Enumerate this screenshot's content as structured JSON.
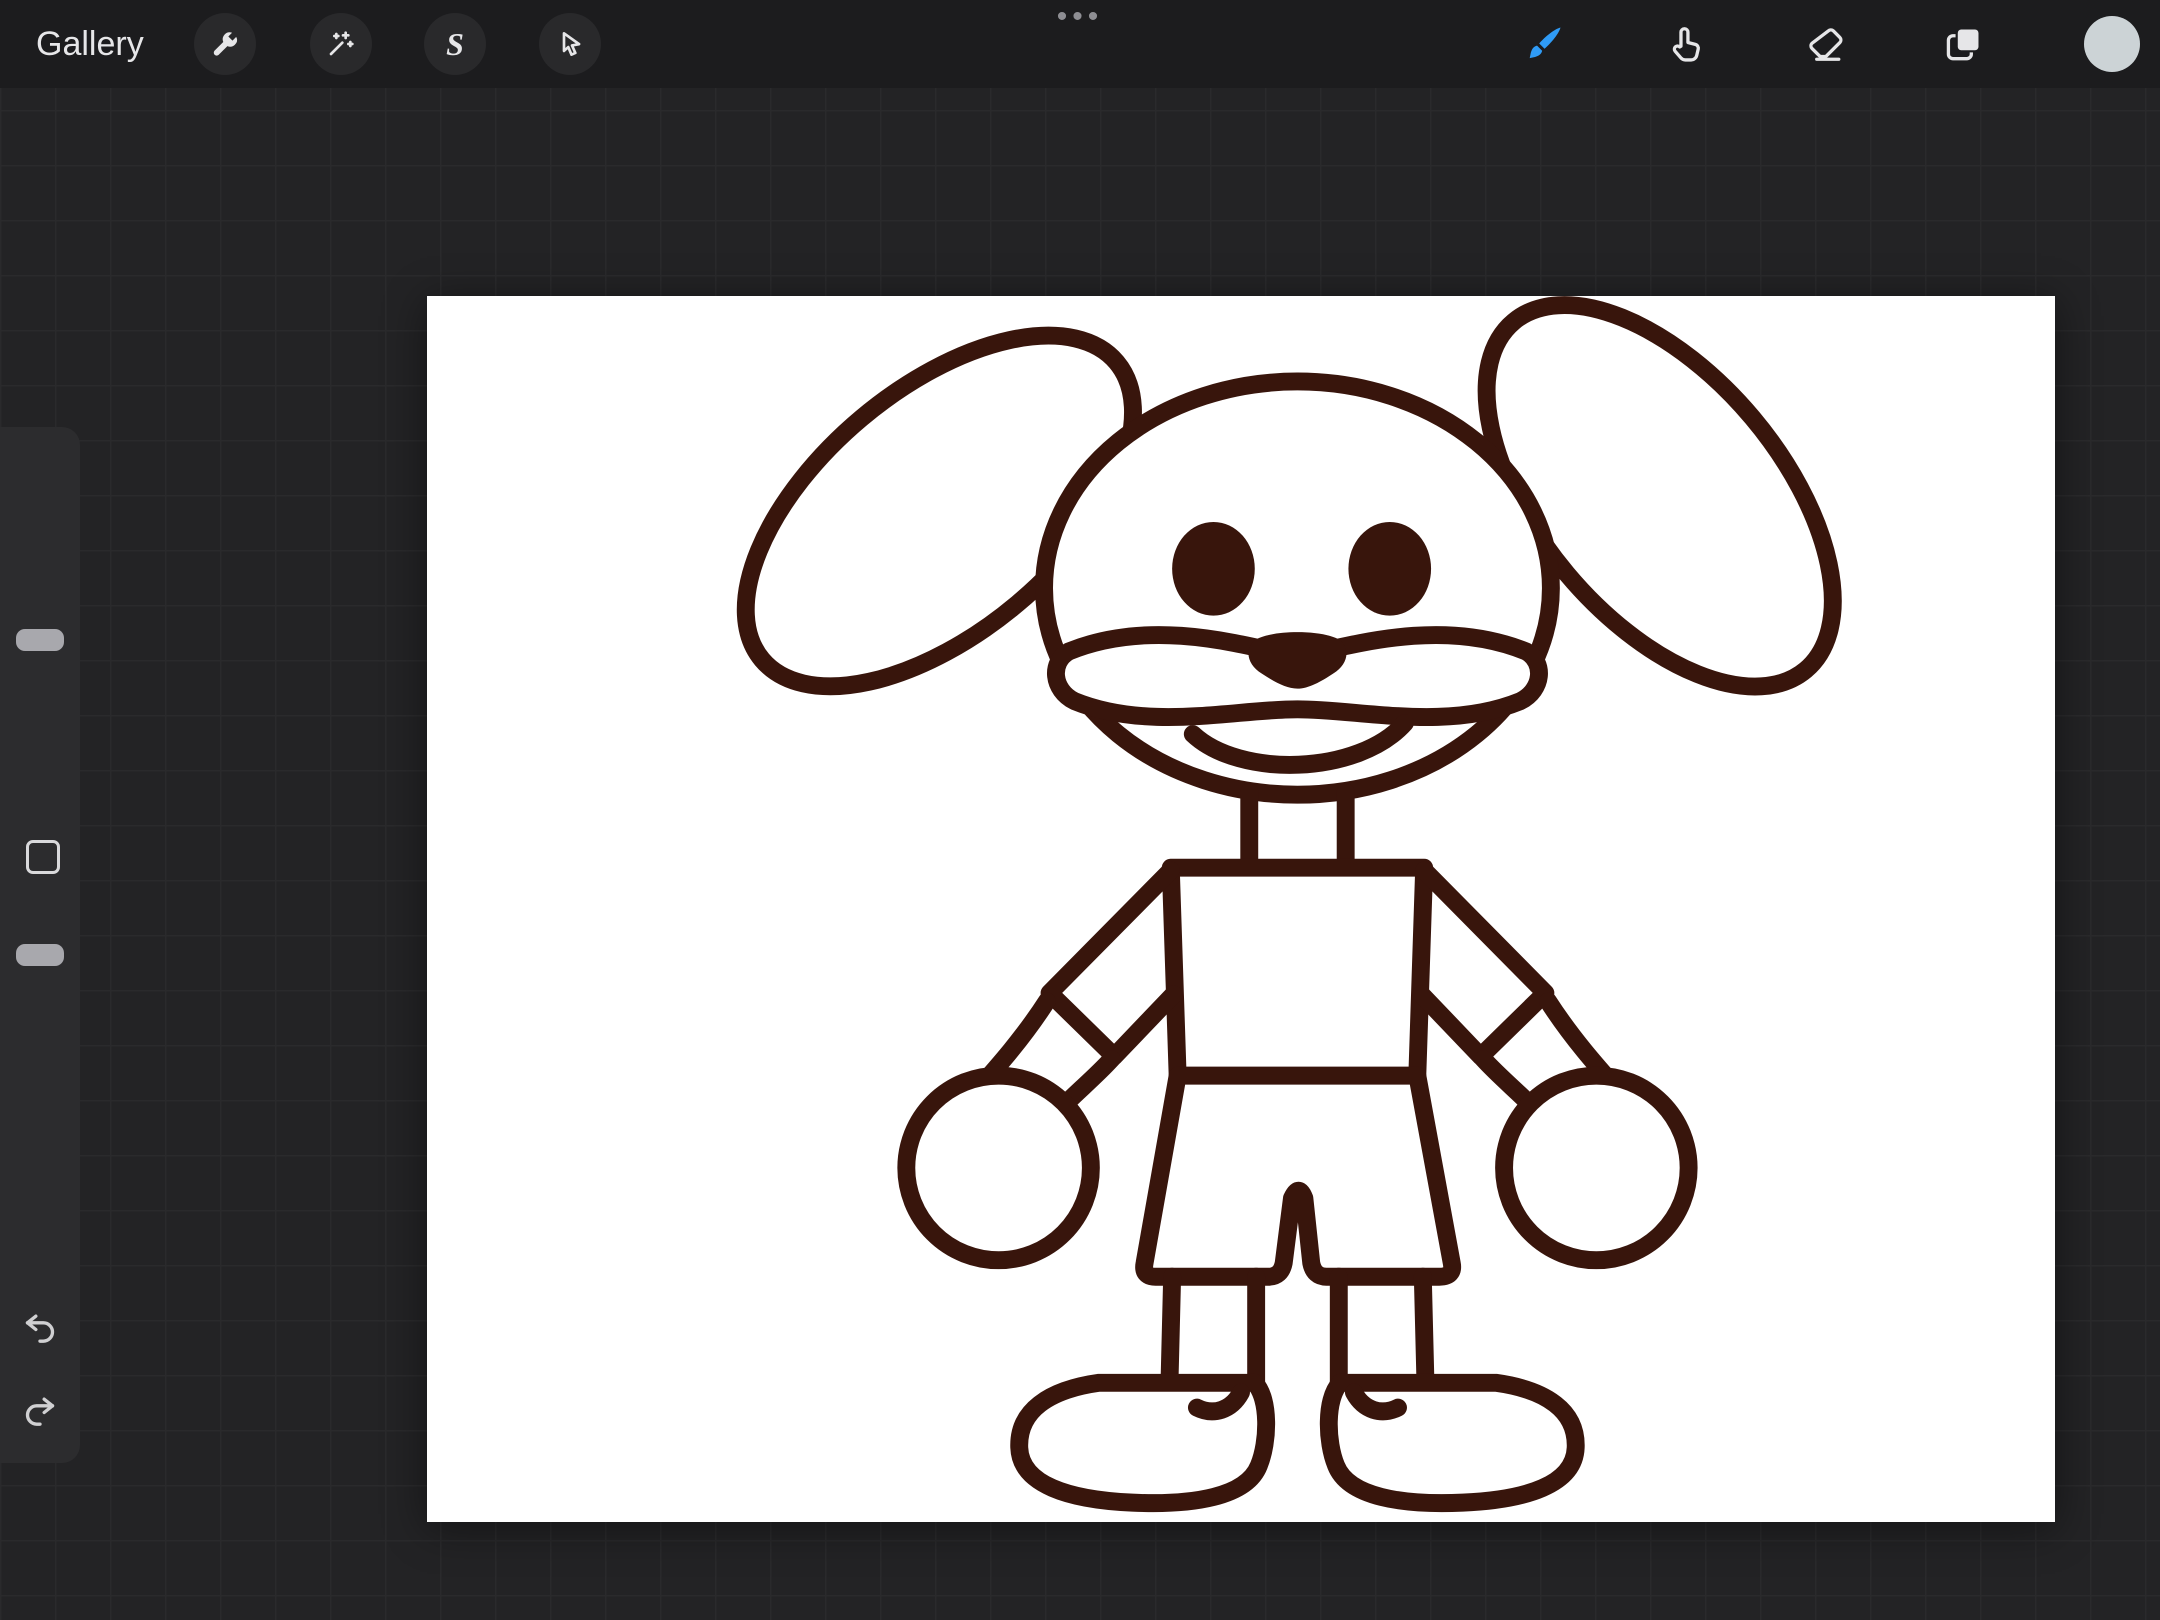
{
  "colors": {
    "bg": "#232325",
    "topbar": "#1c1c1e",
    "canvas": "#ffffff",
    "ink": "#38150c",
    "accent": "#2f9bf6",
    "icon": "#e6e6e8",
    "muted": "#8e8e93",
    "sidebar": "#2c2c2e",
    "handle": "#a8a8ad",
    "swatch": "#ccd3d6",
    "button_bg": "#29292b",
    "grid": "#2a2a2c"
  },
  "topbar": {
    "gallery_label": "Gallery",
    "more_dots": "•••",
    "selection_glyph": "S",
    "left_tools": [
      {
        "id": "actions",
        "icon": "wrench-icon"
      },
      {
        "id": "adjustments",
        "icon": "magic-wand-icon"
      },
      {
        "id": "selection",
        "icon": "selection-s-icon"
      },
      {
        "id": "transform",
        "icon": "transform-arrow-icon"
      }
    ],
    "right_tools": [
      {
        "id": "paint",
        "icon": "brush-icon",
        "active": true
      },
      {
        "id": "smudge",
        "icon": "smudge-finger-icon",
        "active": false
      },
      {
        "id": "erase",
        "icon": "eraser-icon",
        "active": false
      },
      {
        "id": "layers",
        "icon": "layers-icon",
        "active": false
      },
      {
        "id": "color",
        "icon": "color-swatch-circle",
        "active": false
      }
    ]
  },
  "sidebar": {
    "controls": [
      "brush-size-slider",
      "modify-button",
      "opacity-slider",
      "undo",
      "redo"
    ]
  },
  "canvas": {
    "subject": "Dark-brown line drawing of a cartoon bunny with long floppy ears, round head, dark oval eyes, dark nose, wide smiling muzzle, wearing a t-shirt and shorts, mitten hands and large rounded shoes"
  }
}
